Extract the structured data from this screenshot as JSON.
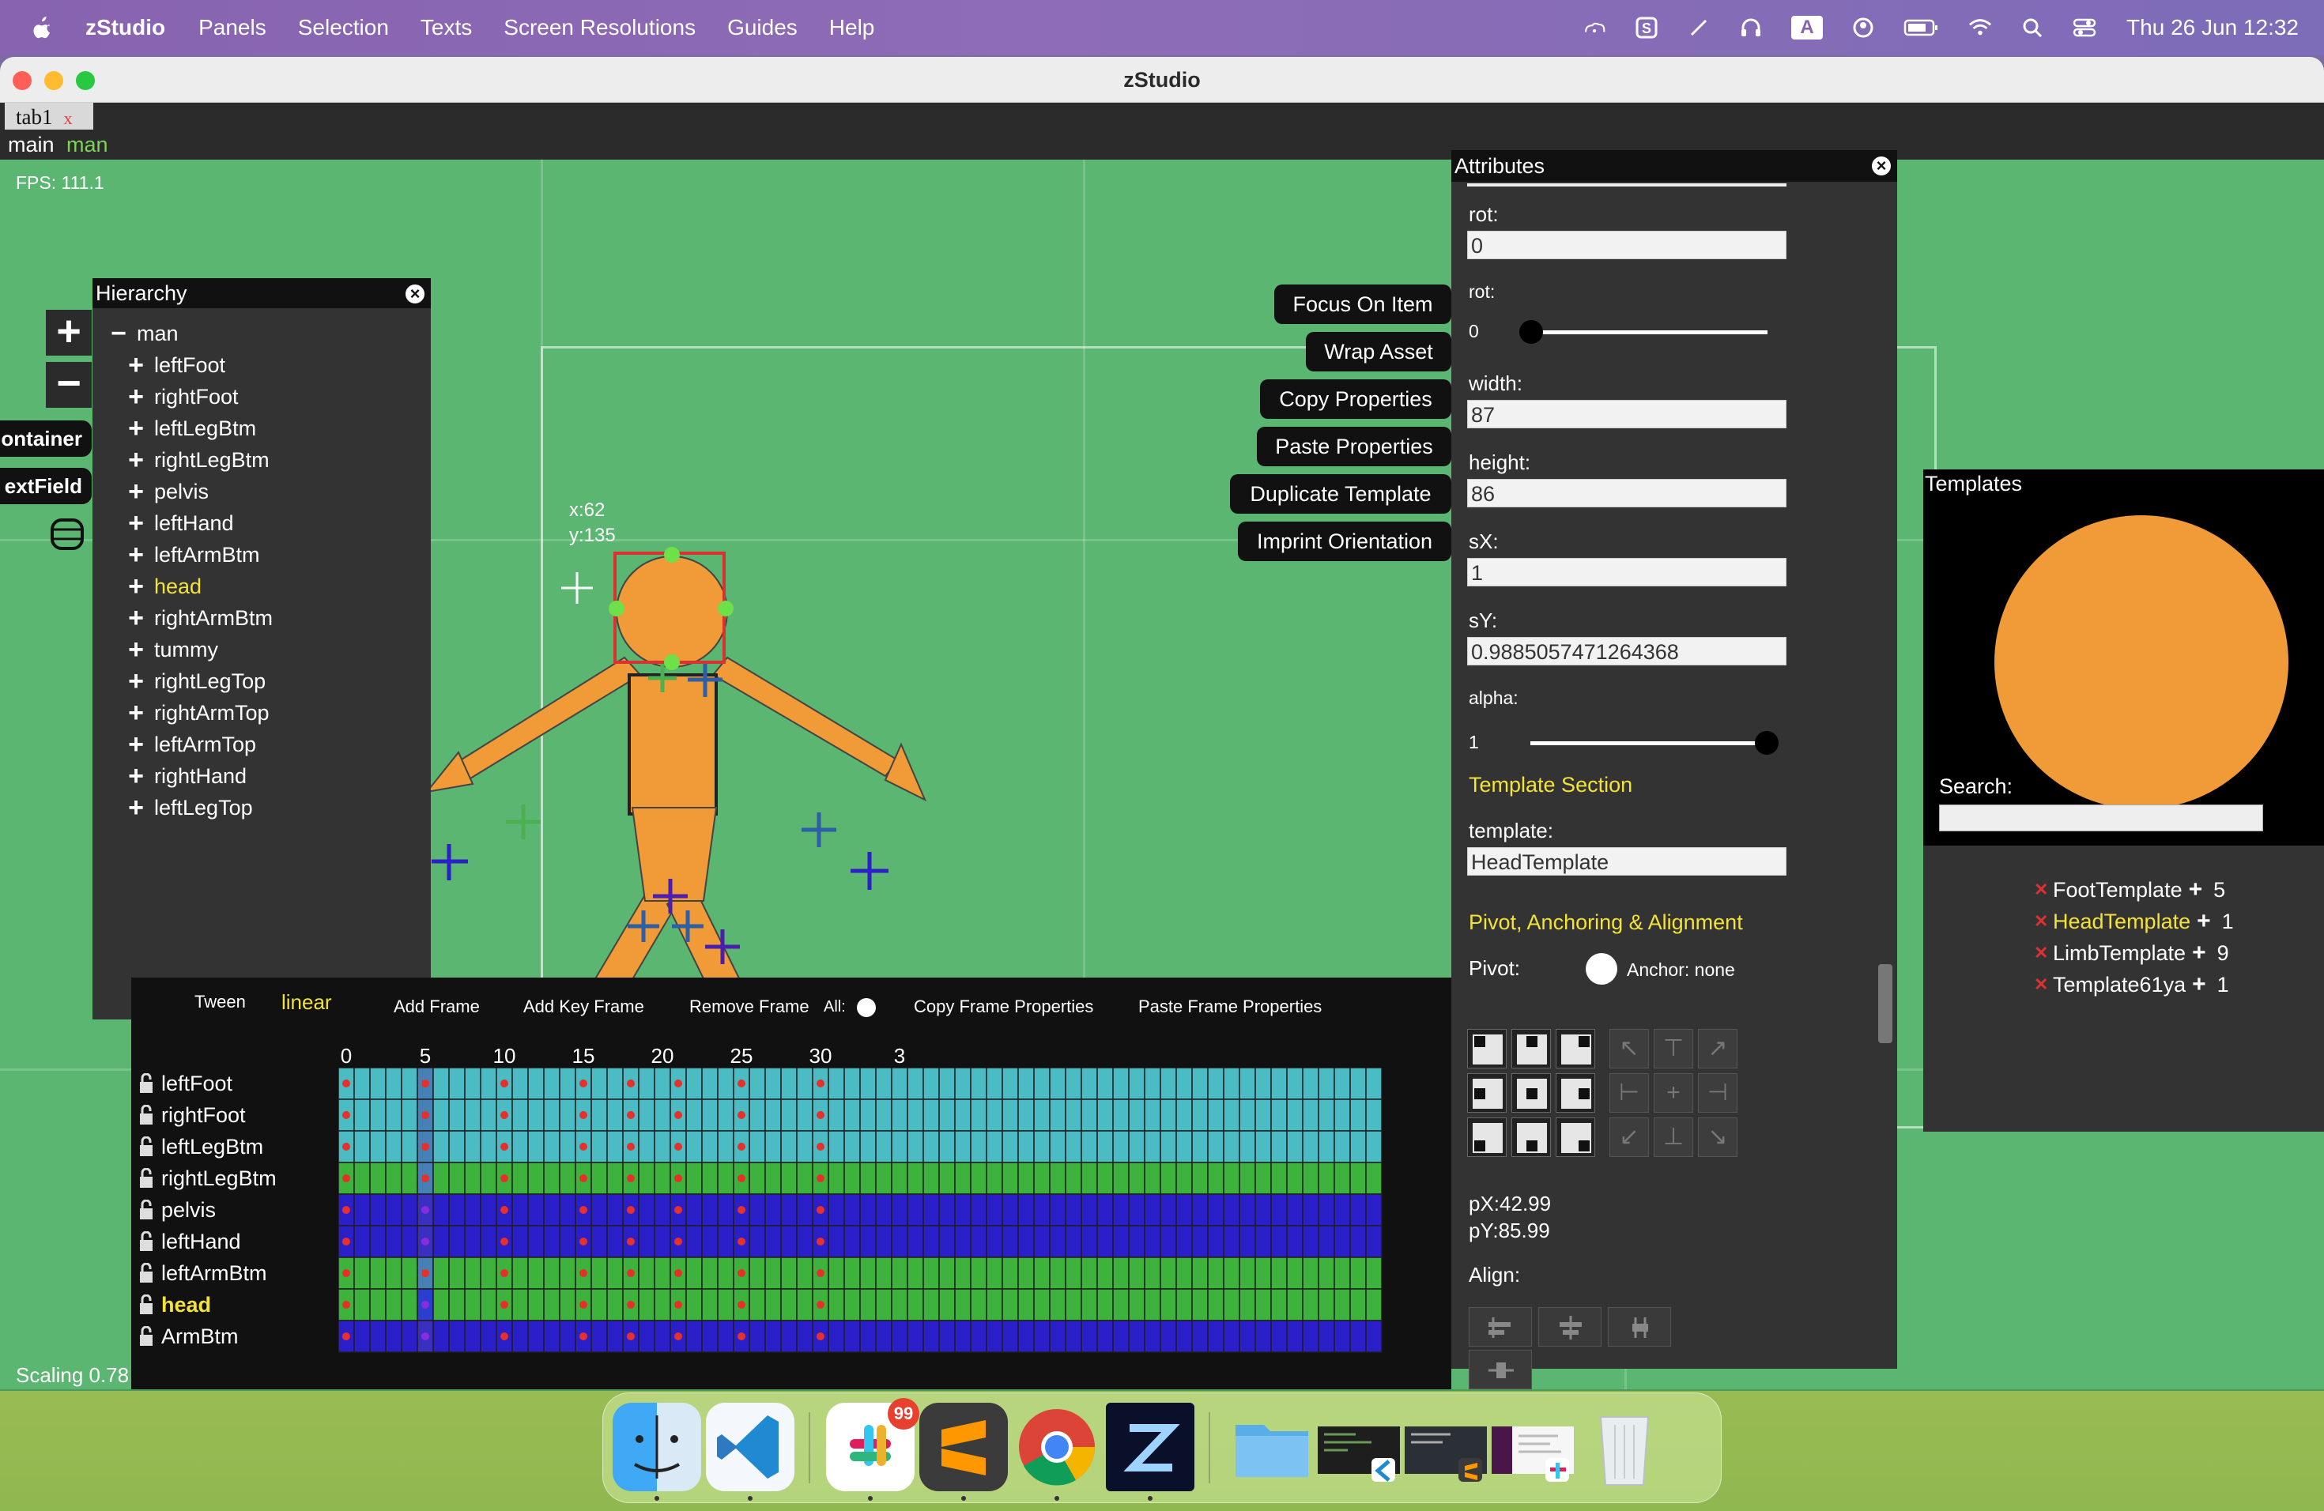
{
  "menubar": {
    "app_name": "zStudio",
    "menus": [
      "Panels",
      "Selection",
      "Texts",
      "Screen Resolutions",
      "Guides",
      "Help"
    ],
    "status_icons": [
      "cloud-sync-icon",
      "s-icon",
      "pen-icon",
      "headphones-icon",
      "keyboard-a-icon",
      "user-circle-icon",
      "battery-icon",
      "wifi-icon",
      "search-icon",
      "control-center-icon"
    ],
    "keyboard_letter": "A",
    "clock": "Thu 26 Jun  12:32"
  },
  "window": {
    "title": "zStudio",
    "tab": {
      "label": "tab1",
      "close": "x"
    },
    "breadcrumb": {
      "root": "main",
      "current": "man"
    }
  },
  "stage": {
    "fps": "FPS: 111.1",
    "scaling": "Scaling 0.78",
    "cursor_x": "x:62",
    "cursor_y": "y:135",
    "zoom_in": "+",
    "zoom_out": "−",
    "side_buttons": [
      "ontainer",
      "extField"
    ]
  },
  "hierarchy": {
    "title": "Hierarchy",
    "close": "×",
    "root": {
      "sign": "−",
      "label": "man"
    },
    "items": [
      {
        "label": "leftFoot",
        "selected": false
      },
      {
        "label": "rightFoot",
        "selected": false
      },
      {
        "label": "leftLegBtm",
        "selected": false
      },
      {
        "label": "rightLegBtm",
        "selected": false
      },
      {
        "label": "pelvis",
        "selected": false
      },
      {
        "label": "leftHand",
        "selected": false
      },
      {
        "label": "leftArmBtm",
        "selected": false
      },
      {
        "label": "head",
        "selected": true
      },
      {
        "label": "rightArmBtm",
        "selected": false
      },
      {
        "label": "tummy",
        "selected": false
      },
      {
        "label": "rightLegTop",
        "selected": false
      },
      {
        "label": "rightArmTop",
        "selected": false
      },
      {
        "label": "leftArmTop",
        "selected": false
      },
      {
        "label": "rightHand",
        "selected": false
      },
      {
        "label": "leftLegTop",
        "selected": false
      }
    ],
    "child_sign": "+"
  },
  "actions": [
    "Focus On Item",
    "Wrap Asset",
    "Copy Properties",
    "Paste Properties",
    "Duplicate Template",
    "Imprint Orientation"
  ],
  "timeline": {
    "tween_label": "Tween",
    "tween_value": "linear",
    "add_frame": "Add Frame",
    "add_key_frame": "Add Key Frame",
    "remove_frame": "Remove Frame",
    "all_label": "All:",
    "copy_frame_props": "Copy Frame Properties",
    "paste_frame_props": "Paste Frame Properties",
    "frame_numbers": [
      "0",
      "5",
      "10",
      "15",
      "20",
      "25",
      "30",
      "3"
    ],
    "tracks": [
      {
        "label": "leftFoot",
        "color": "#4bbcc3",
        "selected": false
      },
      {
        "label": "rightFoot",
        "color": "#4bbcc3",
        "selected": false
      },
      {
        "label": "leftLegBtm",
        "color": "#4bbcc3",
        "selected": false
      },
      {
        "label": "rightLegBtm",
        "color": "#3db23d",
        "selected": false
      },
      {
        "label": "pelvis",
        "color": "#2b1fc9",
        "selected": false
      },
      {
        "label": "leftHand",
        "color": "#2b1fc9",
        "selected": false
      },
      {
        "label": "leftArmBtm",
        "color": "#3db23d",
        "selected": false
      },
      {
        "label": "head",
        "color": "#3db23d",
        "selected": true
      },
      {
        "label": "ArmBtm",
        "color": "#2b1fc9",
        "selected": false
      }
    ],
    "keyframes": [
      0,
      5,
      10,
      15,
      18,
      21,
      25,
      30
    ],
    "current_frame": 5
  },
  "attributes": {
    "title": "Attributes",
    "close": "×",
    "rot_label": "rot:",
    "rot_value": "0",
    "rot_slider_label": "rot:",
    "rot_slider_value": "0",
    "rot_slider_fraction": 0.0,
    "width_label": "width:",
    "width_value": "87",
    "height_label": "height:",
    "height_value": "86",
    "sx_label": "sX:",
    "sx_value": "1",
    "sy_label": "sY:",
    "sy_value": "0.9885057471264368",
    "alpha_label": "alpha:",
    "alpha_value": "1",
    "alpha_fraction": 1.0,
    "template_section": "Template Section",
    "template_label": "template:",
    "template_value": "HeadTemplate",
    "pivot_section": "Pivot, Anchoring & Alignment",
    "pivot_label": "Pivot:",
    "anchor_label": "Anchor: none",
    "px": "pX:42.99",
    "py": "pY:85.99",
    "align_label": "Align:"
  },
  "templates": {
    "title": "Templates",
    "search_label": "Search:",
    "preview_color": "#f09a38",
    "items": [
      {
        "name": "FootTemplate",
        "count": "5",
        "selected": false
      },
      {
        "name": "HeadTemplate",
        "count": "1",
        "selected": true
      },
      {
        "name": "LimbTemplate",
        "count": "9",
        "selected": false
      },
      {
        "name": "Template61ya",
        "count": "1",
        "selected": false
      }
    ]
  },
  "dock": {
    "apps": [
      "finder-icon",
      "vscode-icon",
      "slack-icon",
      "sublime-text-icon",
      "chrome-icon",
      "zstudio-icon",
      "downloads-folder-icon",
      "vscode-window-thumbnail",
      "sublime-window-thumbnail",
      "slack-window-thumbnail",
      "trash-icon"
    ],
    "slack_badge": "99"
  },
  "colors": {
    "stage_green": "#5bb671",
    "panel_dark": "#333333",
    "highlight_yellow": "#f2e23a",
    "character_orange": "#f09a38"
  }
}
